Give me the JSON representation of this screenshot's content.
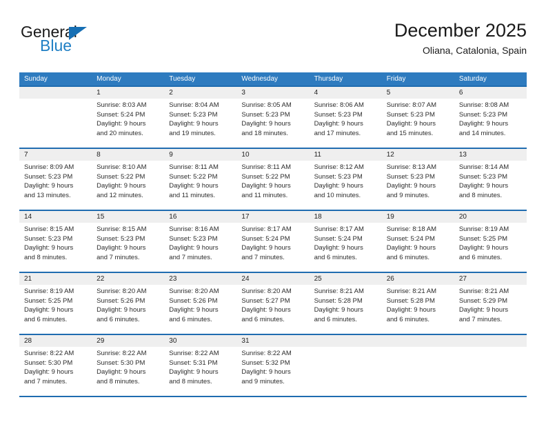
{
  "brand": {
    "name_part1": "General",
    "name_part2": "Blue",
    "triangle_color": "#166fb4",
    "blue_color": "#1f7fc4"
  },
  "header": {
    "title": "December 2025",
    "location": "Oliana, Catalonia, Spain"
  },
  "theme": {
    "header_band": "#2e7bbf",
    "separator": "#1f6cb0",
    "daynum_band": "#efefef"
  },
  "weekdays": [
    "Sunday",
    "Monday",
    "Tuesday",
    "Wednesday",
    "Thursday",
    "Friday",
    "Saturday"
  ],
  "weeks": [
    [
      {
        "day": "",
        "lines": [
          "",
          "",
          "",
          ""
        ]
      },
      {
        "day": "1",
        "lines": [
          "Sunrise: 8:03 AM",
          "Sunset: 5:24 PM",
          "Daylight: 9 hours",
          "and 20 minutes."
        ]
      },
      {
        "day": "2",
        "lines": [
          "Sunrise: 8:04 AM",
          "Sunset: 5:23 PM",
          "Daylight: 9 hours",
          "and 19 minutes."
        ]
      },
      {
        "day": "3",
        "lines": [
          "Sunrise: 8:05 AM",
          "Sunset: 5:23 PM",
          "Daylight: 9 hours",
          "and 18 minutes."
        ]
      },
      {
        "day": "4",
        "lines": [
          "Sunrise: 8:06 AM",
          "Sunset: 5:23 PM",
          "Daylight: 9 hours",
          "and 17 minutes."
        ]
      },
      {
        "day": "5",
        "lines": [
          "Sunrise: 8:07 AM",
          "Sunset: 5:23 PM",
          "Daylight: 9 hours",
          "and 15 minutes."
        ]
      },
      {
        "day": "6",
        "lines": [
          "Sunrise: 8:08 AM",
          "Sunset: 5:23 PM",
          "Daylight: 9 hours",
          "and 14 minutes."
        ]
      }
    ],
    [
      {
        "day": "7",
        "lines": [
          "Sunrise: 8:09 AM",
          "Sunset: 5:23 PM",
          "Daylight: 9 hours",
          "and 13 minutes."
        ]
      },
      {
        "day": "8",
        "lines": [
          "Sunrise: 8:10 AM",
          "Sunset: 5:22 PM",
          "Daylight: 9 hours",
          "and 12 minutes."
        ]
      },
      {
        "day": "9",
        "lines": [
          "Sunrise: 8:11 AM",
          "Sunset: 5:22 PM",
          "Daylight: 9 hours",
          "and 11 minutes."
        ]
      },
      {
        "day": "10",
        "lines": [
          "Sunrise: 8:11 AM",
          "Sunset: 5:22 PM",
          "Daylight: 9 hours",
          "and 11 minutes."
        ]
      },
      {
        "day": "11",
        "lines": [
          "Sunrise: 8:12 AM",
          "Sunset: 5:23 PM",
          "Daylight: 9 hours",
          "and 10 minutes."
        ]
      },
      {
        "day": "12",
        "lines": [
          "Sunrise: 8:13 AM",
          "Sunset: 5:23 PM",
          "Daylight: 9 hours",
          "and 9 minutes."
        ]
      },
      {
        "day": "13",
        "lines": [
          "Sunrise: 8:14 AM",
          "Sunset: 5:23 PM",
          "Daylight: 9 hours",
          "and 8 minutes."
        ]
      }
    ],
    [
      {
        "day": "14",
        "lines": [
          "Sunrise: 8:15 AM",
          "Sunset: 5:23 PM",
          "Daylight: 9 hours",
          "and 8 minutes."
        ]
      },
      {
        "day": "15",
        "lines": [
          "Sunrise: 8:15 AM",
          "Sunset: 5:23 PM",
          "Daylight: 9 hours",
          "and 7 minutes."
        ]
      },
      {
        "day": "16",
        "lines": [
          "Sunrise: 8:16 AM",
          "Sunset: 5:23 PM",
          "Daylight: 9 hours",
          "and 7 minutes."
        ]
      },
      {
        "day": "17",
        "lines": [
          "Sunrise: 8:17 AM",
          "Sunset: 5:24 PM",
          "Daylight: 9 hours",
          "and 7 minutes."
        ]
      },
      {
        "day": "18",
        "lines": [
          "Sunrise: 8:17 AM",
          "Sunset: 5:24 PM",
          "Daylight: 9 hours",
          "and 6 minutes."
        ]
      },
      {
        "day": "19",
        "lines": [
          "Sunrise: 8:18 AM",
          "Sunset: 5:24 PM",
          "Daylight: 9 hours",
          "and 6 minutes."
        ]
      },
      {
        "day": "20",
        "lines": [
          "Sunrise: 8:19 AM",
          "Sunset: 5:25 PM",
          "Daylight: 9 hours",
          "and 6 minutes."
        ]
      }
    ],
    [
      {
        "day": "21",
        "lines": [
          "Sunrise: 8:19 AM",
          "Sunset: 5:25 PM",
          "Daylight: 9 hours",
          "and 6 minutes."
        ]
      },
      {
        "day": "22",
        "lines": [
          "Sunrise: 8:20 AM",
          "Sunset: 5:26 PM",
          "Daylight: 9 hours",
          "and 6 minutes."
        ]
      },
      {
        "day": "23",
        "lines": [
          "Sunrise: 8:20 AM",
          "Sunset: 5:26 PM",
          "Daylight: 9 hours",
          "and 6 minutes."
        ]
      },
      {
        "day": "24",
        "lines": [
          "Sunrise: 8:20 AM",
          "Sunset: 5:27 PM",
          "Daylight: 9 hours",
          "and 6 minutes."
        ]
      },
      {
        "day": "25",
        "lines": [
          "Sunrise: 8:21 AM",
          "Sunset: 5:28 PM",
          "Daylight: 9 hours",
          "and 6 minutes."
        ]
      },
      {
        "day": "26",
        "lines": [
          "Sunrise: 8:21 AM",
          "Sunset: 5:28 PM",
          "Daylight: 9 hours",
          "and 6 minutes."
        ]
      },
      {
        "day": "27",
        "lines": [
          "Sunrise: 8:21 AM",
          "Sunset: 5:29 PM",
          "Daylight: 9 hours",
          "and 7 minutes."
        ]
      }
    ],
    [
      {
        "day": "28",
        "lines": [
          "Sunrise: 8:22 AM",
          "Sunset: 5:30 PM",
          "Daylight: 9 hours",
          "and 7 minutes."
        ]
      },
      {
        "day": "29",
        "lines": [
          "Sunrise: 8:22 AM",
          "Sunset: 5:30 PM",
          "Daylight: 9 hours",
          "and 8 minutes."
        ]
      },
      {
        "day": "30",
        "lines": [
          "Sunrise: 8:22 AM",
          "Sunset: 5:31 PM",
          "Daylight: 9 hours",
          "and 8 minutes."
        ]
      },
      {
        "day": "31",
        "lines": [
          "Sunrise: 8:22 AM",
          "Sunset: 5:32 PM",
          "Daylight: 9 hours",
          "and 9 minutes."
        ]
      },
      {
        "day": "",
        "lines": [
          "",
          "",
          "",
          ""
        ]
      },
      {
        "day": "",
        "lines": [
          "",
          "",
          "",
          ""
        ]
      },
      {
        "day": "",
        "lines": [
          "",
          "",
          "",
          ""
        ]
      }
    ]
  ]
}
